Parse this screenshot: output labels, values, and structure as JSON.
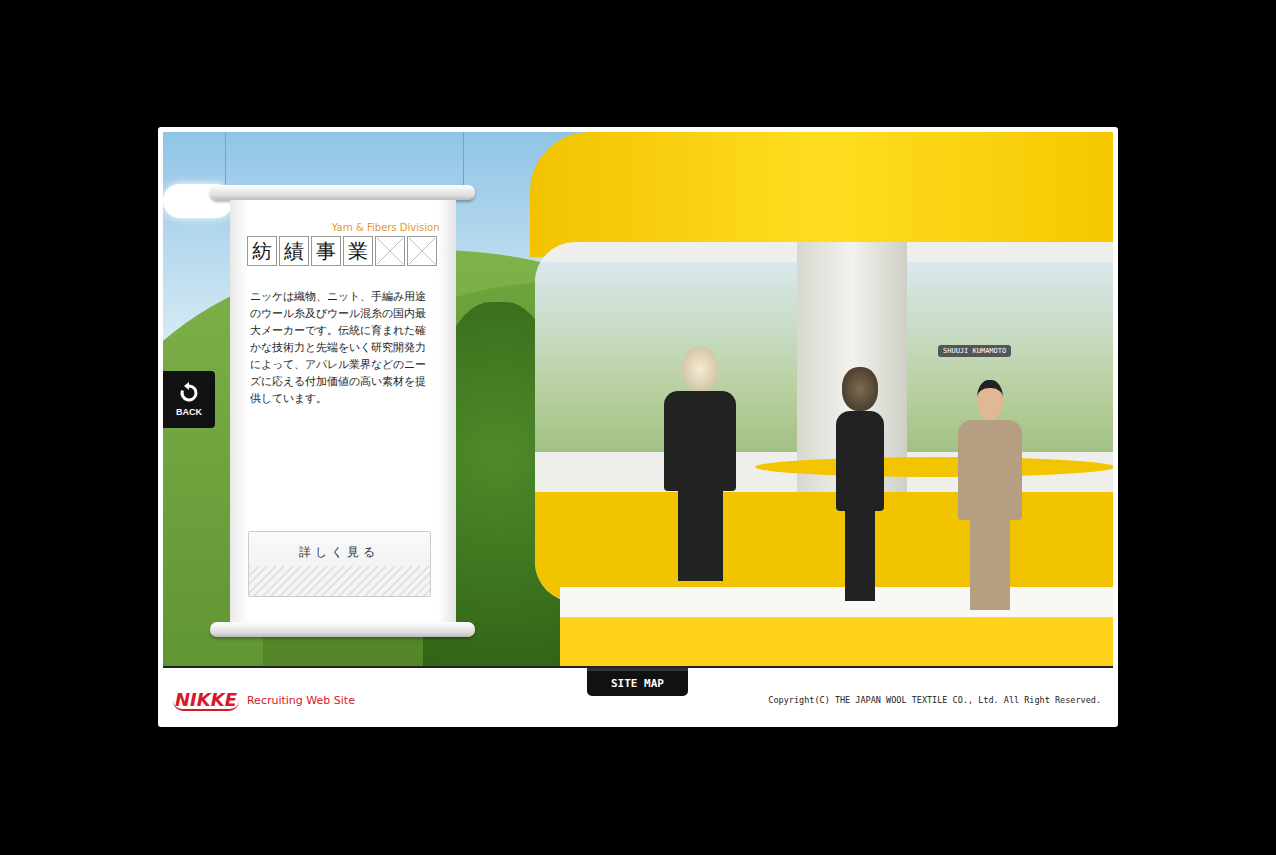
{
  "back_button": {
    "label": "BACK"
  },
  "panel": {
    "subtitle": "Yarn & Fibers Division",
    "title": "紡績事業",
    "empty_title_boxes": 2,
    "description": "ニッケは織物、ニット、手編み用途のウール糸及びウール混糸の国内最大メーカーです。伝統に育まれた確かな技術力と先端をいく研究開発力によって、アパレル業界などのニーズに応える付加価値の高い素材を提供しています。",
    "button": "詳しく見る"
  },
  "scene": {
    "name_tag": "SHUUJI KUMAMOTO"
  },
  "footer": {
    "logo": "NIKKE",
    "site_label": "Recruiting Web Site",
    "site_map": "SITE MAP",
    "copyright": "Copyright(C) THE JAPAN WOOL TEXTILE CO., Ltd. All Right Reserved."
  }
}
